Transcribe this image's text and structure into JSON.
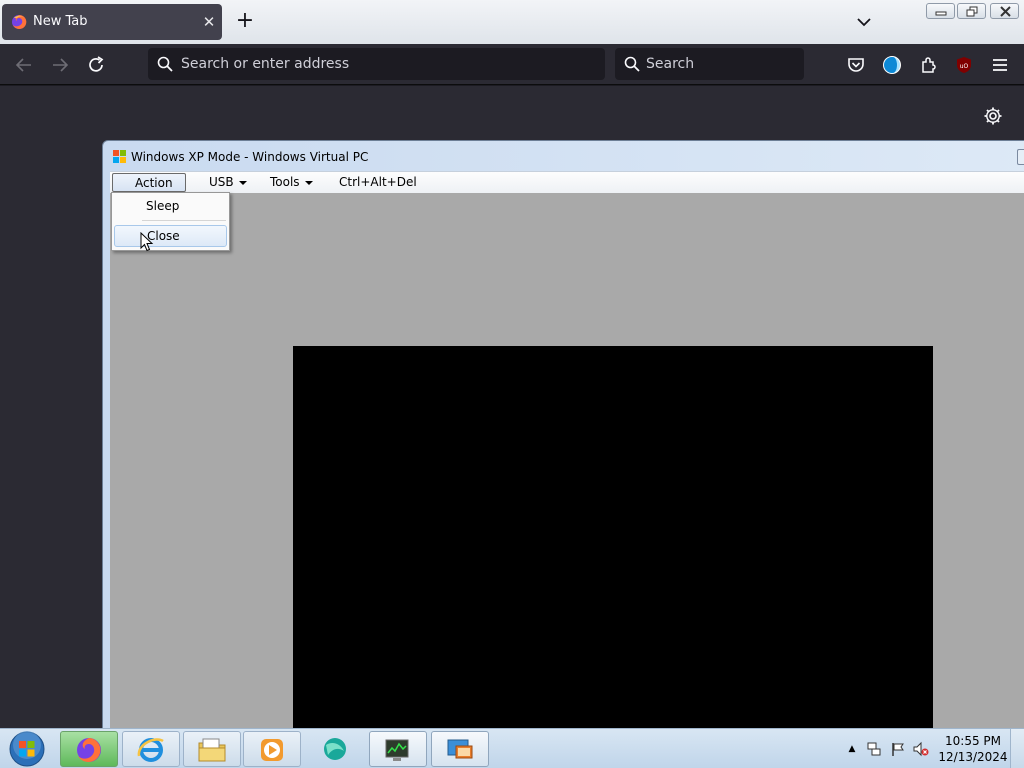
{
  "browser": {
    "tab": {
      "title": "New Tab",
      "favicon": "firefox-icon"
    },
    "address_placeholder": "Search or enter address",
    "search_placeholder": "Search",
    "accent": "#2b2a33"
  },
  "vpc_window": {
    "title": "Windows XP Mode - Windows Virtual PC",
    "menu": [
      {
        "label": "Action"
      },
      {
        "label": "USB"
      },
      {
        "label": "Tools"
      },
      {
        "label": "Ctrl+Alt+Del"
      }
    ],
    "action_menu_items": [
      {
        "label": "Sleep"
      },
      {
        "label": "Close"
      }
    ]
  },
  "taskbar": {
    "time": "10:55 PM",
    "date": "12/13/2024"
  }
}
